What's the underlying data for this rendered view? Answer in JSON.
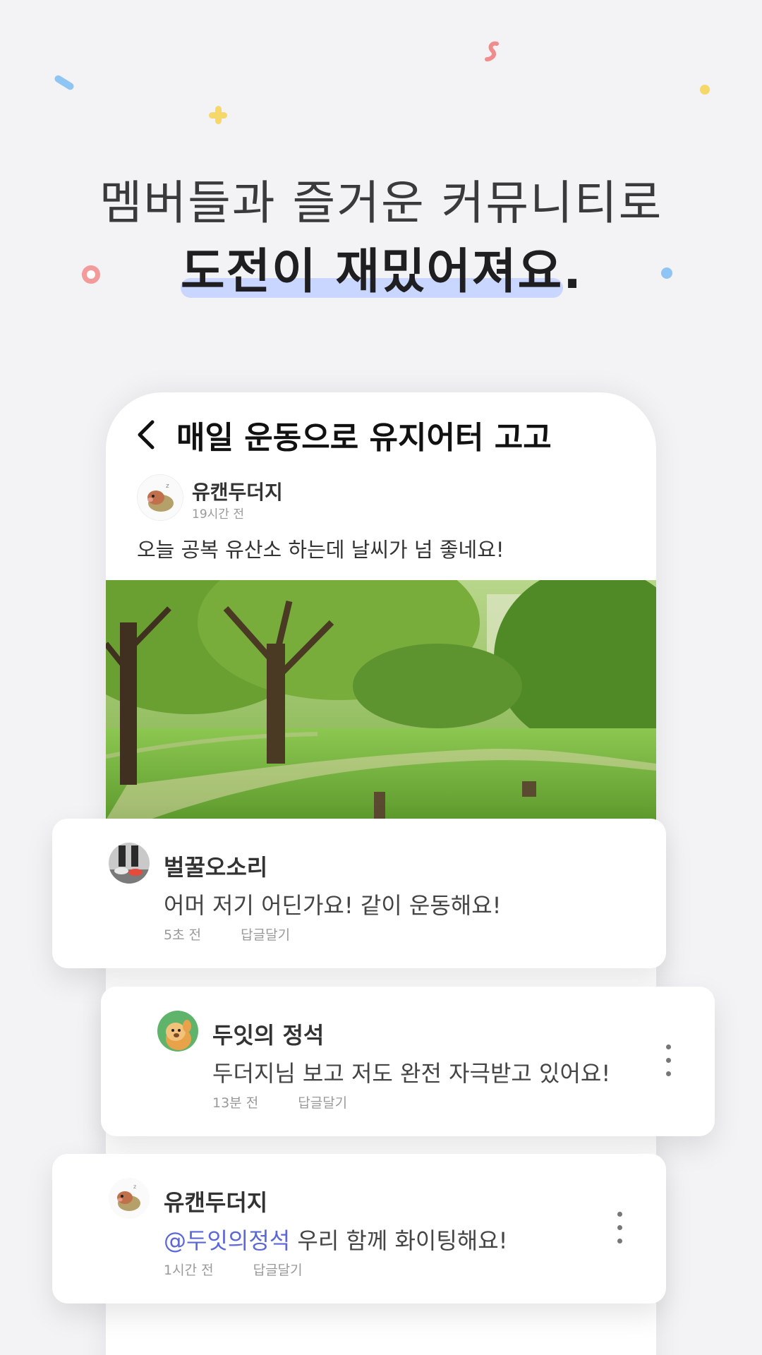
{
  "headline": {
    "line1": "멤버들과 즐거운 커뮤니티로",
    "line2": "도전이 재밌어져요",
    "period": "."
  },
  "screen": {
    "title": "매일 운동으로 유지어터 고고",
    "post": {
      "author": "유캔두더지",
      "time": "19시간 전",
      "text": "오늘 공복 유산소 하는데 날씨가 넘 좋네요!"
    }
  },
  "comments": [
    {
      "author": "벌꿀오소리",
      "text": "어머 저기 어딘가요! 같이 운동해요!",
      "time": "5초 전",
      "reply_label": "답글달기"
    },
    {
      "author": "두잇의 정석",
      "text": "두더지님 보고 저도 완전 자극받고 있어요!",
      "time": "13분 전",
      "reply_label": "답글달기"
    },
    {
      "author": "유캔두더지",
      "mention": "@두잇의정석",
      "text": " 우리 함께 화이팅해요!",
      "time": "1시간 전",
      "reply_label": "답글달기"
    }
  ],
  "colors": {
    "accent_highlight": "#c9d6ff",
    "mention": "#5b67d8",
    "background": "#f3f3f5"
  },
  "icons": [
    "back-arrow-icon",
    "more-vertical-icon"
  ]
}
